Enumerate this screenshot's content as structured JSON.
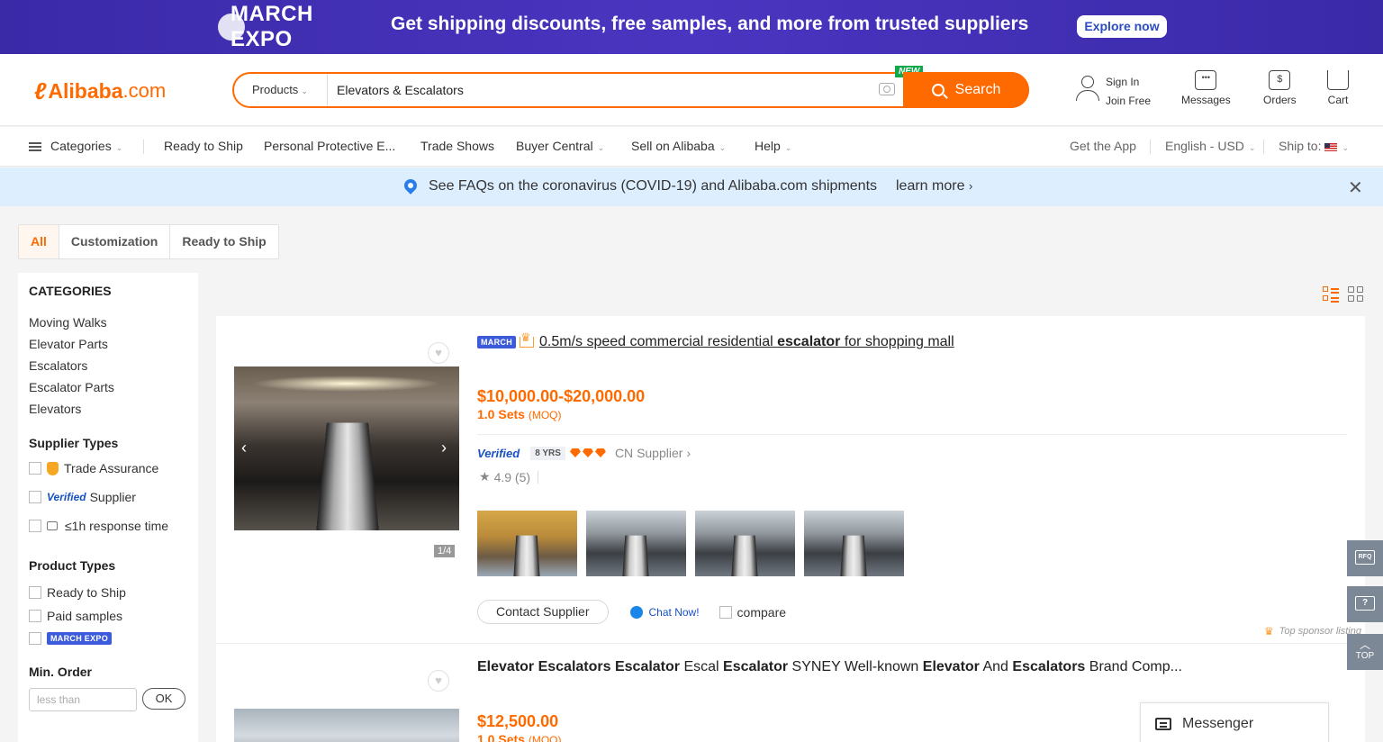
{
  "promo": {
    "logo_text": "MARCH EXPO",
    "headline": "Get shipping discounts, free samples, and more from trusted suppliers",
    "cta": "Explore now"
  },
  "header": {
    "brand_name": "Alibaba",
    "brand_tld": ".com",
    "search": {
      "category": "Products",
      "query": "Elevators & Escalators",
      "new_tag": "NEW",
      "button": "Search"
    },
    "sign_in": "Sign In",
    "join_free": "Join Free",
    "messages": "Messages",
    "orders": "Orders",
    "cart": "Cart"
  },
  "navbar": {
    "categories": "Categories",
    "items": [
      "Ready to Ship",
      "Personal Protective E...",
      "Trade Shows",
      "Buyer Central",
      "Sell on Alibaba",
      "Help"
    ],
    "get_app": "Get the App",
    "language": "English - USD",
    "ship_to": "Ship to:"
  },
  "notice": {
    "message": "See FAQs on the coronavirus (COVID-19) and Alibaba.com shipments",
    "link": "learn more"
  },
  "tabs": [
    "All",
    "Customization",
    "Ready to Ship"
  ],
  "sidebar": {
    "categories_title": "CATEGORIES",
    "categories": [
      "Moving Walks",
      "Elevator Parts",
      "Escalators",
      "Escalator Parts",
      "Elevators"
    ],
    "supplier_types_title": "Supplier Types",
    "supplier_types": {
      "trade_assurance": "Trade Assurance",
      "verified_badge": "Verified",
      "supplier": "Supplier",
      "response": "≤1h response time"
    },
    "product_types_title": "Product Types",
    "product_types": [
      "Ready to Ship",
      "Paid samples"
    ],
    "march_expo_badge": "MARCH EXPO",
    "min_order_title": "Min. Order",
    "min_order_placeholder": "less than",
    "ok": "OK"
  },
  "products": [
    {
      "march_badge": "MARCH",
      "title_parts": [
        "0.5m/s speed commercial residential ",
        "escalator",
        " for shopping mall"
      ],
      "price": "$10,000.00-$20,000.00",
      "moq_value": "1.0 Sets",
      "moq_label": "(MOQ)",
      "verified": "Verified",
      "years": "8 YRS",
      "country": "CN",
      "supplier_label": "Supplier",
      "rating": "4.9",
      "reviews": "(5)",
      "image_counter": "1/4",
      "contact": "Contact Supplier",
      "chat": "Chat Now!",
      "compare": "compare",
      "sponsor": "Top sponsor listing"
    },
    {
      "title_parts": [
        "Elevator Escalators Escalator",
        " Escal ",
        "Escalator",
        " SYNEY Well-known ",
        "Elevator",
        " And ",
        "Escalators",
        " Brand Comp..."
      ],
      "price": "$12,500.00",
      "moq_value": "1.0 Sets",
      "moq_label": "(MOQ)"
    }
  ],
  "float": {
    "rfq": "RFQ",
    "top": "TOP"
  },
  "messenger": "Messenger",
  "colors": {
    "accent": "#ff6a00",
    "promo_bg": "#3a2aa8",
    "notice_bg": "#ddeeff",
    "verified": "#1851c4"
  }
}
